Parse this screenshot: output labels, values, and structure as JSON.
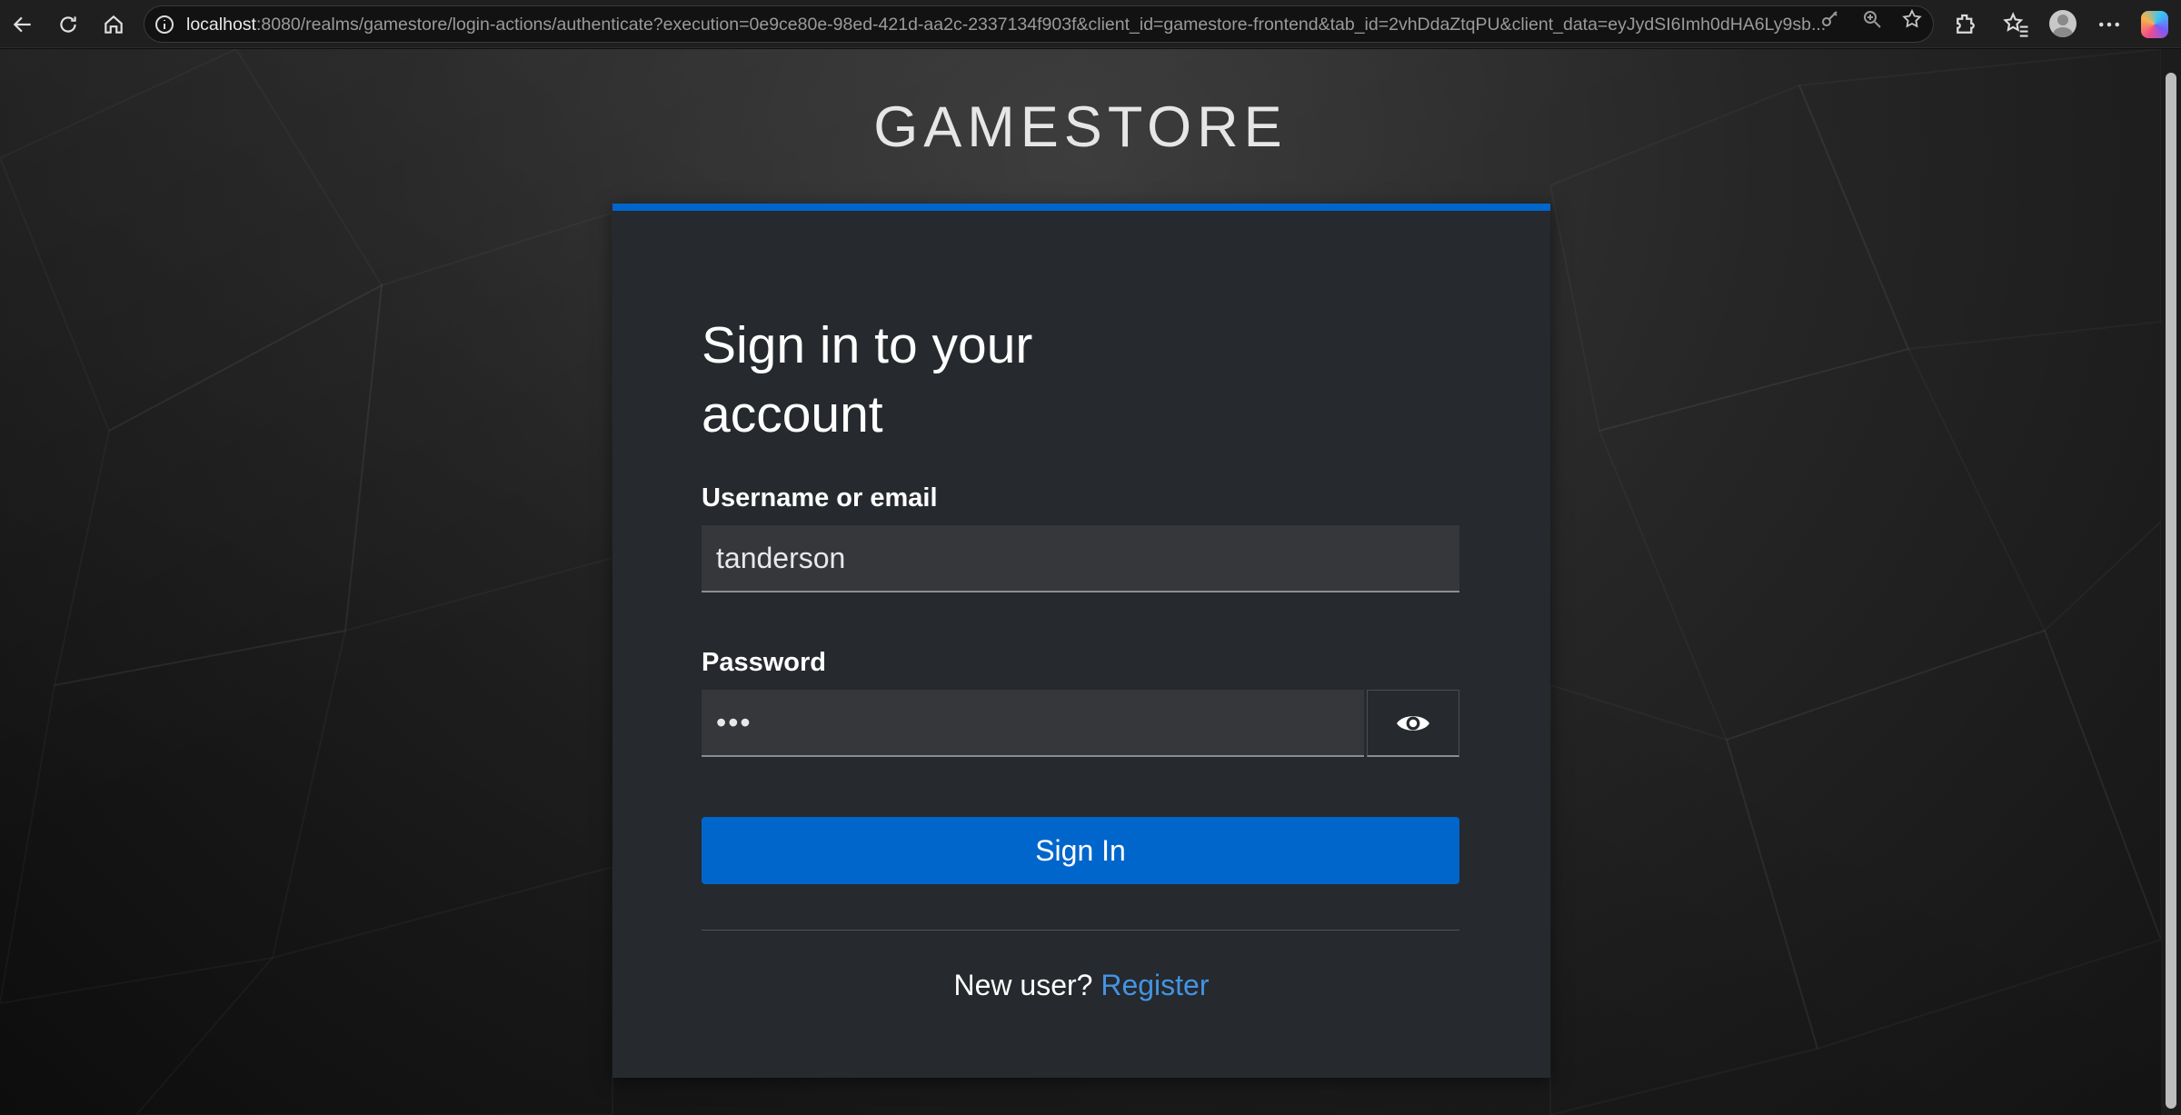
{
  "browser": {
    "url_host": "localhost",
    "url_rest": ":8080/realms/gamestore/login-actions/authenticate?execution=0e9ce80e-98ed-421d-aa2c-2337134f903f&client_id=gamestore-frontend&tab_id=2vhDdaZtqPU&client_data=eyJydSI6Imh0dHA6Ly9sb..."
  },
  "page": {
    "brand": "GAMESTORE",
    "title": "Sign in to your account",
    "username_label": "Username or email",
    "username_value": "tanderson",
    "password_label": "Password",
    "password_value": "•••",
    "sign_in_label": "Sign In",
    "new_user_text": "New user?",
    "register_link": "Register"
  },
  "colors": {
    "accent": "#0066cc",
    "card_bg": "#26292d",
    "link": "#4394e5"
  },
  "icons": [
    "back-icon",
    "reload-icon",
    "home-icon",
    "info-icon",
    "key-icon",
    "zoom-icon",
    "star-icon",
    "extensions-icon",
    "favorites-icon",
    "profile-avatar",
    "more-icon",
    "copilot-icon",
    "eye-icon"
  ]
}
